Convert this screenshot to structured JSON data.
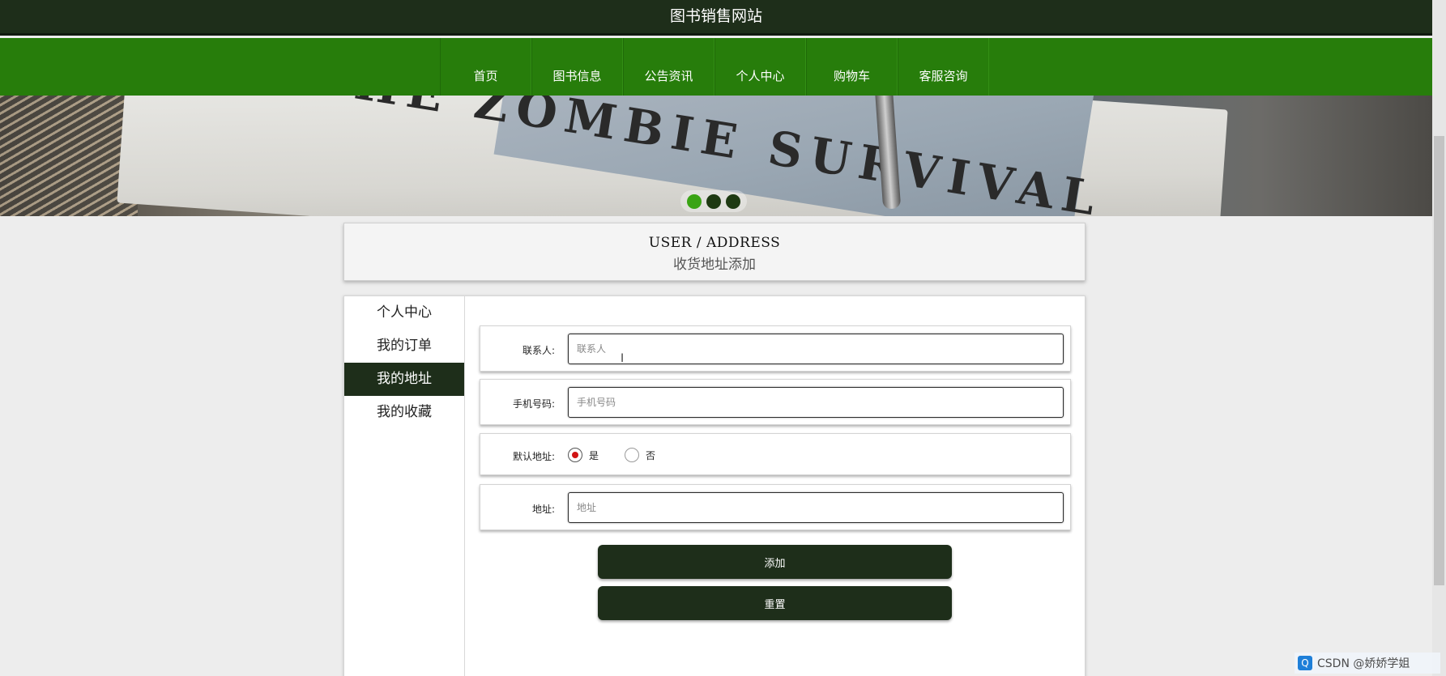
{
  "site_title": "图书销售网站",
  "nav": [
    "首页",
    "图书信息",
    "公告资讯",
    "个人中心",
    "购物车",
    "客服咨询"
  ],
  "banner": {
    "spine_text": "THE ZOMBIE SURVIVAL",
    "slide_count": 3,
    "active_slide": 0
  },
  "page_heading": {
    "en": "USER / ADDRESS",
    "cn": "收货地址添加"
  },
  "sidebar": {
    "items": [
      "个人中心",
      "我的订单",
      "我的地址",
      "我的收藏"
    ],
    "active": "我的地址"
  },
  "form": {
    "contact": {
      "label": "联系人:",
      "placeholder": "联系人",
      "value": ""
    },
    "phone": {
      "label": "手机号码:",
      "placeholder": "手机号码",
      "value": ""
    },
    "default_address": {
      "label": "默认地址:",
      "options": [
        "是",
        "否"
      ],
      "selected": "是"
    },
    "address": {
      "label": "地址:",
      "placeholder": "地址",
      "value": ""
    }
  },
  "buttons": {
    "add": "添加",
    "reset": "重置"
  },
  "watermark": "CSDN @娇娇学姐",
  "colors": {
    "header": "#1e2e1a",
    "nav": "#277d0b",
    "accent_green": "#3aa414",
    "radio_on": "#d01414"
  }
}
